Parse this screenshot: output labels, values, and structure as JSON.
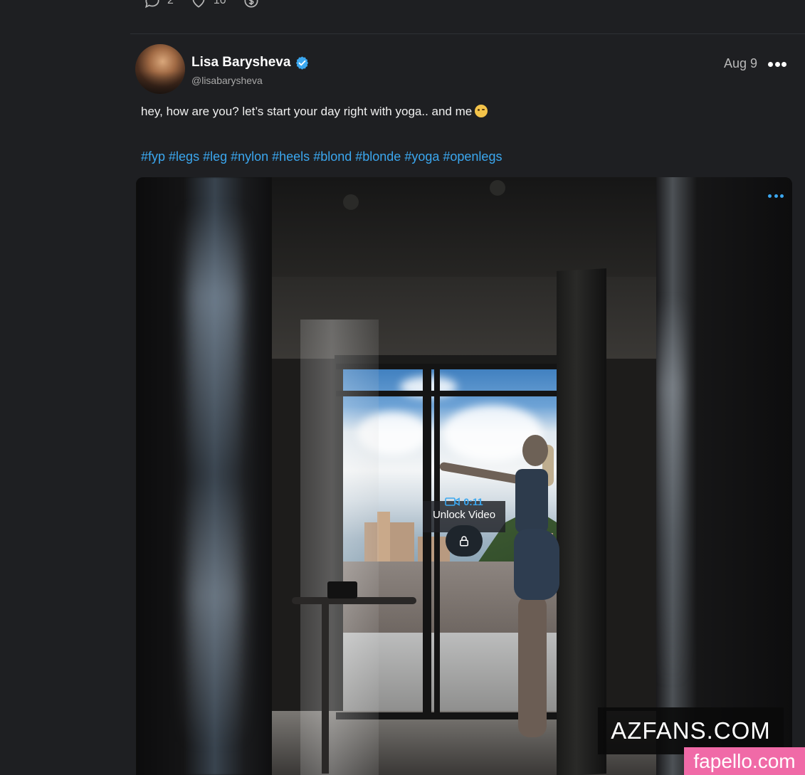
{
  "previous_post": {
    "comments_count": "2",
    "likes_count": "10"
  },
  "post": {
    "author": {
      "display_name": "Lisa Barysheva",
      "handle": "@lisabarysheva",
      "verified": true
    },
    "date": "Aug 9",
    "text": "hey, how are you? let’s start your day right with yoga.. and me",
    "hashtags": [
      "#fyp",
      "#legs",
      "#leg",
      "#nylon",
      "#heels",
      "#blond",
      "#blonde",
      "#yoga",
      "#openlegs"
    ],
    "media": {
      "video_duration": "0:11",
      "unlock_label": "Unlock Video"
    }
  },
  "watermarks": {
    "azfans": "AZFANS.COM",
    "fapello": "fapello.com"
  },
  "colors": {
    "background": "#1e1f22",
    "accent": "#3ba7ef",
    "verified": "#3ba7ef",
    "fapello_badge": "#f06aa7"
  },
  "icons": {
    "comment": "comment-icon",
    "like": "heart-icon",
    "tip": "dollar-coin-icon",
    "verified": "verified-badge-icon",
    "more": "more-dots-icon",
    "video": "video-camera-icon",
    "lock": "lock-icon"
  }
}
